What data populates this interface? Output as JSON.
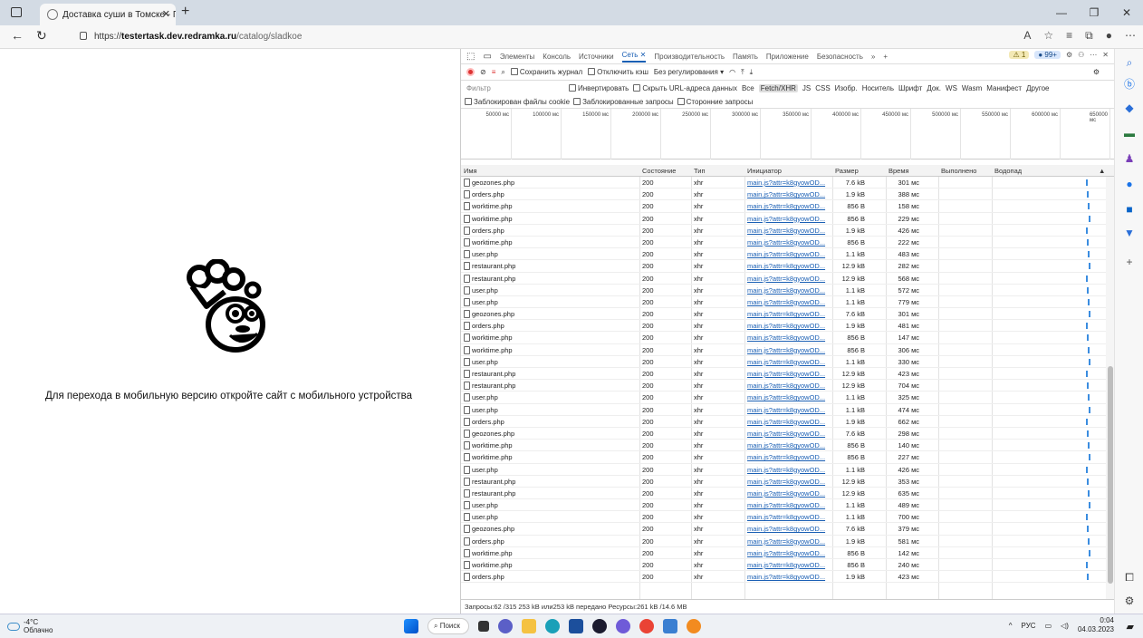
{
  "browser": {
    "tab_title": "Доставка суши в Томске - Панд",
    "url_prefix": "https://",
    "url_host": "testertask.dev.redramka.ru",
    "url_path": "/catalog/sladkoe"
  },
  "page": {
    "mobile_message": "Для перехода в мобильную версию откройте сайт с мобильного устройства"
  },
  "devtools": {
    "tabs": [
      "Элементы",
      "Консоль",
      "Источники",
      "Сеть",
      "Производительность",
      "Память",
      "Приложение",
      "Безопасность"
    ],
    "active_tab": "Сеть",
    "warn_count": "1",
    "issue_count": "99+",
    "toolbar": {
      "preserve_log": "Сохранить журнал",
      "disable_cache": "Отключить кэш",
      "throttling": "Без регулирования"
    },
    "filter": {
      "placeholder": "Фильтр",
      "invert": "Инвертировать",
      "hide_data_urls": "Скрыть URL-адреса данных",
      "types": [
        "Все",
        "Fetch/XHR",
        "JS",
        "CSS",
        "Изобр.",
        "Носитель",
        "Шрифт",
        "Док.",
        "WS",
        "Wasm",
        "Манифест",
        "Другое"
      ],
      "active_type": "Fetch/XHR",
      "blocked_cookies": "Заблокирован файлы cookie",
      "blocked_requests": "Заблокированные запросы",
      "third_party": "Сторонние запросы"
    },
    "timeline_ticks": [
      "50000 мс",
      "100000 мс",
      "150000 мс",
      "200000 мс",
      "250000 мс",
      "300000 мс",
      "350000 мс",
      "400000 мс",
      "450000 мс",
      "500000 мс",
      "550000 мс",
      "600000 мс",
      "650000 мс"
    ],
    "columns": {
      "name": "Имя",
      "status": "Состояние",
      "type": "Тип",
      "initiator": "Инициатор",
      "size": "Размер",
      "time": "Время",
      "fulfilled": "Выполнено",
      "waterfall": "Водопад"
    },
    "rows": [
      {
        "name": "geozones.php",
        "status": "200",
        "type": "xhr",
        "initiator": "main.js?attr=k8gyowOD...",
        "size": "7.6 kB",
        "time": "301 мс"
      },
      {
        "name": "orders.php",
        "status": "200",
        "type": "xhr",
        "initiator": "main.js?attr=k8gyowOD...",
        "size": "1.9 kB",
        "time": "388 мс"
      },
      {
        "name": "worktime.php",
        "status": "200",
        "type": "xhr",
        "initiator": "main.js?attr=k8gyowOD...",
        "size": "856 B",
        "time": "158 мс"
      },
      {
        "name": "worktime.php",
        "status": "200",
        "type": "xhr",
        "initiator": "main.js?attr=k8gyowOD...",
        "size": "856 B",
        "time": "229 мс"
      },
      {
        "name": "orders.php",
        "status": "200",
        "type": "xhr",
        "initiator": "main.js?attr=k8gyowOD...",
        "size": "1.9 kB",
        "time": "426 мс"
      },
      {
        "name": "worktime.php",
        "status": "200",
        "type": "xhr",
        "initiator": "main.js?attr=k8gyowOD...",
        "size": "856 B",
        "time": "222 мс"
      },
      {
        "name": "user.php",
        "status": "200",
        "type": "xhr",
        "initiator": "main.js?attr=k8gyowOD...",
        "size": "1.1 kB",
        "time": "483 мс"
      },
      {
        "name": "restaurant.php",
        "status": "200",
        "type": "xhr",
        "initiator": "main.js?attr=k8gyowOD...",
        "size": "12.9 kB",
        "time": "282 мс"
      },
      {
        "name": "restaurant.php",
        "status": "200",
        "type": "xhr",
        "initiator": "main.js?attr=k8gyowOD...",
        "size": "12.9 kB",
        "time": "568 мс"
      },
      {
        "name": "user.php",
        "status": "200",
        "type": "xhr",
        "initiator": "main.js?attr=k8gyowOD...",
        "size": "1.1 kB",
        "time": "572 мс"
      },
      {
        "name": "user.php",
        "status": "200",
        "type": "xhr",
        "initiator": "main.js?attr=k8gyowOD...",
        "size": "1.1 kB",
        "time": "779 мс"
      },
      {
        "name": "geozones.php",
        "status": "200",
        "type": "xhr",
        "initiator": "main.js?attr=k8gyowOD...",
        "size": "7.6 kB",
        "time": "301 мс"
      },
      {
        "name": "orders.php",
        "status": "200",
        "type": "xhr",
        "initiator": "main.js?attr=k8gyowOD...",
        "size": "1.9 kB",
        "time": "481 мс"
      },
      {
        "name": "worktime.php",
        "status": "200",
        "type": "xhr",
        "initiator": "main.js?attr=k8gyowOD...",
        "size": "856 B",
        "time": "147 мс"
      },
      {
        "name": "worktime.php",
        "status": "200",
        "type": "xhr",
        "initiator": "main.js?attr=k8gyowOD...",
        "size": "856 B",
        "time": "306 мс"
      },
      {
        "name": "user.php",
        "status": "200",
        "type": "xhr",
        "initiator": "main.js?attr=k8gyowOD...",
        "size": "1.1 kB",
        "time": "330 мс"
      },
      {
        "name": "restaurant.php",
        "status": "200",
        "type": "xhr",
        "initiator": "main.js?attr=k8gyowOD...",
        "size": "12.9 kB",
        "time": "423 мс"
      },
      {
        "name": "restaurant.php",
        "status": "200",
        "type": "xhr",
        "initiator": "main.js?attr=k8gyowOD...",
        "size": "12.9 kB",
        "time": "704 мс"
      },
      {
        "name": "user.php",
        "status": "200",
        "type": "xhr",
        "initiator": "main.js?attr=k8gyowOD...",
        "size": "1.1 kB",
        "time": "325 мс"
      },
      {
        "name": "user.php",
        "status": "200",
        "type": "xhr",
        "initiator": "main.js?attr=k8gyowOD...",
        "size": "1.1 kB",
        "time": "474 мс"
      },
      {
        "name": "orders.php",
        "status": "200",
        "type": "xhr",
        "initiator": "main.js?attr=k8gyowOD...",
        "size": "1.9 kB",
        "time": "662 мс"
      },
      {
        "name": "geozones.php",
        "status": "200",
        "type": "xhr",
        "initiator": "main.js?attr=k8gyowOD...",
        "size": "7.6 kB",
        "time": "298 мс"
      },
      {
        "name": "worktime.php",
        "status": "200",
        "type": "xhr",
        "initiator": "main.js?attr=k8gyowOD...",
        "size": "856 B",
        "time": "140 мс"
      },
      {
        "name": "worktime.php",
        "status": "200",
        "type": "xhr",
        "initiator": "main.js?attr=k8gyowOD...",
        "size": "856 B",
        "time": "227 мс"
      },
      {
        "name": "user.php",
        "status": "200",
        "type": "xhr",
        "initiator": "main.js?attr=k8gyowOD...",
        "size": "1.1 kB",
        "time": "426 мс"
      },
      {
        "name": "restaurant.php",
        "status": "200",
        "type": "xhr",
        "initiator": "main.js?attr=k8gyowOD...",
        "size": "12.9 kB",
        "time": "353 мс"
      },
      {
        "name": "restaurant.php",
        "status": "200",
        "type": "xhr",
        "initiator": "main.js?attr=k8gyowOD...",
        "size": "12.9 kB",
        "time": "635 мс"
      },
      {
        "name": "user.php",
        "status": "200",
        "type": "xhr",
        "initiator": "main.js?attr=k8gyowOD...",
        "size": "1.1 kB",
        "time": "489 мс"
      },
      {
        "name": "user.php",
        "status": "200",
        "type": "xhr",
        "initiator": "main.js?attr=k8gyowOD...",
        "size": "1.1 kB",
        "time": "700 мс"
      },
      {
        "name": "geozones.php",
        "status": "200",
        "type": "xhr",
        "initiator": "main.js?attr=k8gyowOD...",
        "size": "7.6 kB",
        "time": "379 мс"
      },
      {
        "name": "orders.php",
        "status": "200",
        "type": "xhr",
        "initiator": "main.js?attr=k8gyowOD...",
        "size": "1.9 kB",
        "time": "581 мс"
      },
      {
        "name": "worktime.php",
        "status": "200",
        "type": "xhr",
        "initiator": "main.js?attr=k8gyowOD...",
        "size": "856 B",
        "time": "142 мс"
      },
      {
        "name": "worktime.php",
        "status": "200",
        "type": "xhr",
        "initiator": "main.js?attr=k8gyowOD...",
        "size": "856 B",
        "time": "240 мс"
      },
      {
        "name": "orders.php",
        "status": "200",
        "type": "xhr",
        "initiator": "main.js?attr=k8gyowOD...",
        "size": "1.9 kB",
        "time": "423 мс"
      }
    ],
    "status_bar": "Запросы:62 /315  253 kB или253 kB передано  Ресурсы:261 kB /14.6 MB"
  },
  "taskbar": {
    "temperature": "-4°C",
    "weather": "Облачно",
    "search": "Поиск",
    "lang": "РУС",
    "time": "0:04",
    "date": "04.03.2023"
  },
  "colors": {
    "accent": "#1a5fb4",
    "waterfall": "#3b8de0",
    "record": "#dd3333"
  }
}
